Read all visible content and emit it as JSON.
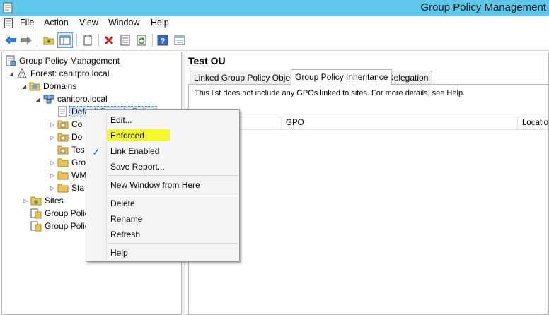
{
  "window": {
    "title": "Group Policy Management"
  },
  "menu": [
    "File",
    "Action",
    "View",
    "Window",
    "Help"
  ],
  "toolbar": {
    "buttons": [
      "back-arrow-icon",
      "forward-arrow-icon",
      "up-folder-icon",
      "show-hide-console-tree-icon",
      "copy-icon",
      "delete-icon",
      "properties-icon",
      "refresh-icon",
      "help-icon",
      "export-list-icon"
    ]
  },
  "tree": {
    "root": "Group Policy Management",
    "forest": "Forest: canitpro.local",
    "domains": "Domains",
    "domain": "canitpro.local",
    "selected": "Default Domain Policy",
    "children_partial": [
      "Co",
      "Do",
      "Tes",
      "Gro",
      "WM",
      "Sta"
    ],
    "sites": "Sites",
    "modeling_partial": "Group Polic",
    "results_partial": "Group Polic"
  },
  "right": {
    "title": "Test OU",
    "tabs": [
      "Linked Group Policy Objects",
      "Group Policy Inheritance",
      "Delegation"
    ],
    "active_tab": "Group Policy Inheritance",
    "note": "This list does not include any GPOs linked to sites. For more details, see Help.",
    "columns": [
      "",
      "GPO",
      "Location"
    ]
  },
  "context_menu": {
    "items": [
      "Edit...",
      "Enforced",
      "Link Enabled",
      "Save Report...",
      "New Window from Here",
      "Delete",
      "Rename",
      "Refresh",
      "Help"
    ],
    "checked": "Link Enabled",
    "highlighted": "Enforced",
    "highlight_color": "#f4fa29"
  },
  "colors": {
    "titlebar": "#5fc8ea",
    "selection": "#cce4f7"
  }
}
